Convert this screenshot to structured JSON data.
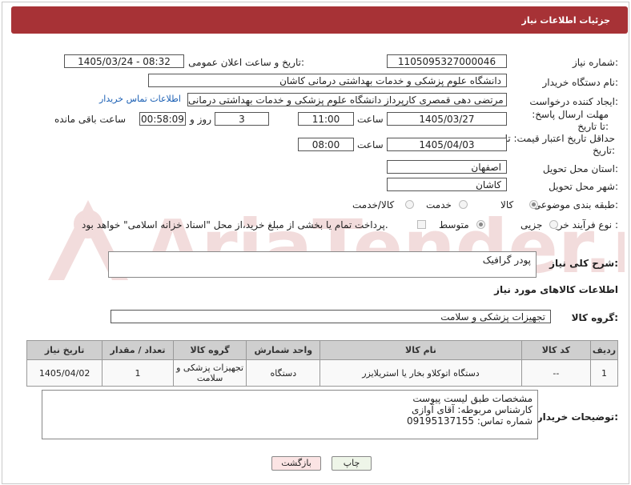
{
  "header": {
    "title": "جزئیات اطلاعات نیاز"
  },
  "form": {
    "need_number_label": "شماره نیاز:",
    "need_number": "1105095327000046",
    "announce_label": "تاریخ و ساعت اعلان عمومی:",
    "announce_value": "1405/03/24 - 08:32",
    "buyer_org_label": "نام دستگاه خریدار:",
    "buyer_org": "دانشگاه علوم پزشکی و خدمات بهداشتی درمانی کاشان",
    "requester_label": "ایجاد کننده درخواست:",
    "requester": "مرتضی دهی قمصری کارپرداز دانشگاه علوم پزشکی و خدمات بهداشتی درمانی",
    "contact_link": "اطلاعات تماس خریدار",
    "deadline_label": "مهلت ارسال پاسخ: تا تاریخ:",
    "deadline_date": "1405/03/27",
    "time_label": "ساعت",
    "deadline_time": "11:00",
    "days_value": "3",
    "days_label": "روز و",
    "remaining_time": "00:58:09",
    "remaining_label": "ساعت باقی مانده",
    "price_valid_label": "حداقل تاریخ اعتبار قیمت: تا تاریخ:",
    "price_valid_date": "1405/04/03",
    "price_valid_time": "08:00",
    "province_label": "استان محل تحویل:",
    "province": "اصفهان",
    "city_label": "شهر محل تحویل:",
    "city": "کاشان",
    "category_label": "طبقه بندی موضوعی:",
    "category_options": [
      "کالا",
      "خدمت",
      "کالا/خدمت"
    ],
    "process_label": "نوع فرآیند خرید :",
    "process_options": [
      "جزیی",
      "متوسط"
    ],
    "payment_note": "پرداخت تمام یا بخشی از مبلغ خرید،از محل \"اسناد خزانه اسلامی\" خواهد بود."
  },
  "summary": {
    "label": "شرح کلی نیاز:",
    "value": "پودر گرافیک"
  },
  "goods_info_title": "اطلاعات کالاهای مورد نیاز",
  "goods_group": {
    "label": "گروه کالا:",
    "value": "تجهیزات پزشکی و سلامت"
  },
  "table": {
    "headers": [
      "ردیف",
      "کد کالا",
      "نام کالا",
      "واحد شمارش",
      "گروه کالا",
      "تعداد / مقدار",
      "تاریخ نیاز"
    ],
    "rows": [
      [
        "1",
        "--",
        "دستگاه اتوکلاو بخار یا استریلایزر",
        "دستگاه",
        "تجهیزات پزشکی و سلامت",
        "1",
        "1405/04/02"
      ]
    ]
  },
  "buyer_notes": {
    "label": "توضیحات خریدار:",
    "lines": [
      "مشخصات طبق لیست پیوست",
      "کارشناس مربوطه: آقای آوازی",
      "شماره تماس: 09195137155"
    ]
  },
  "buttons": {
    "print": "چاپ",
    "back": "بازگشت"
  },
  "watermark": "AriaTender.neT"
}
